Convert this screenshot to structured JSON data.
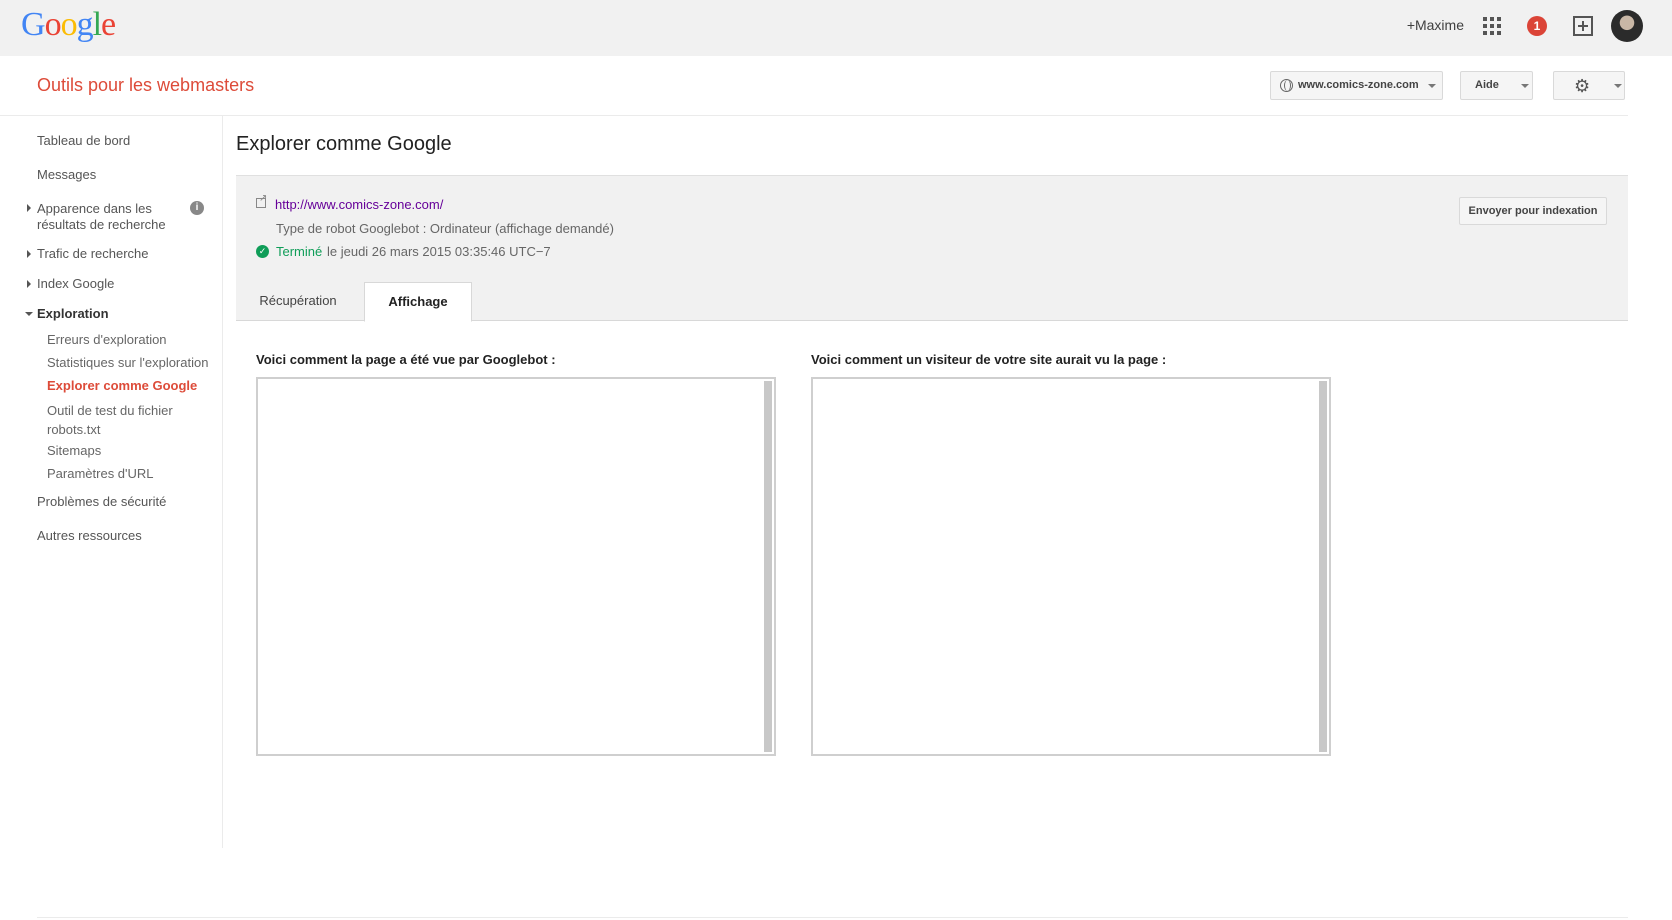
{
  "topbar": {
    "logo": [
      "G",
      "o",
      "o",
      "g",
      "l",
      "e"
    ],
    "user_link": "+Maxime",
    "notification_count": "1"
  },
  "header": {
    "app_title": "Outils pour les webmasters",
    "site_selector": "www.comics-zone.com",
    "help_label": "Aide"
  },
  "sidebar": {
    "items": [
      {
        "label": "Tableau de bord"
      },
      {
        "label": "Messages"
      },
      {
        "label_line1": "Apparence dans les",
        "label_line2": "résultats de recherche"
      },
      {
        "label": "Trafic de recherche"
      },
      {
        "label": "Index Google"
      },
      {
        "label": "Exploration"
      },
      {
        "label": "Problèmes de sécurité"
      },
      {
        "label": "Autres ressources"
      }
    ],
    "exploration_sub": [
      {
        "label": "Erreurs d'exploration"
      },
      {
        "label": "Statistiques sur l'exploration"
      },
      {
        "label": "Explorer comme Google"
      },
      {
        "label_line1": "Outil de test du fichier",
        "label_line2": "robots.txt"
      },
      {
        "label": "Sitemaps"
      },
      {
        "label": "Paramètres d'URL"
      }
    ],
    "info_icon_glyph": "i"
  },
  "main": {
    "page_title": "Explorer comme Google",
    "fetch": {
      "url": "http://www.comics-zone.com/",
      "robot_type": "Type de robot Googlebot : Ordinateur (affichage demandé)",
      "status_label": "Terminé",
      "status_date": "le jeudi 26 mars 2015 03:35:46 UTC−7",
      "submit_label": "Envoyer pour indexation"
    },
    "tabs": [
      {
        "label": "Récupération",
        "active": false
      },
      {
        "label": "Affichage",
        "active": true
      }
    ],
    "googlebot_view_label": "Voici comment la page a été vue par Googlebot :",
    "visitor_view_label": "Voici comment un visiteur de votre site aurait vu la page :"
  },
  "colors": {
    "accent_red": "#dd4b39",
    "status_green": "#0f9d58",
    "visited_link": "#660099"
  }
}
